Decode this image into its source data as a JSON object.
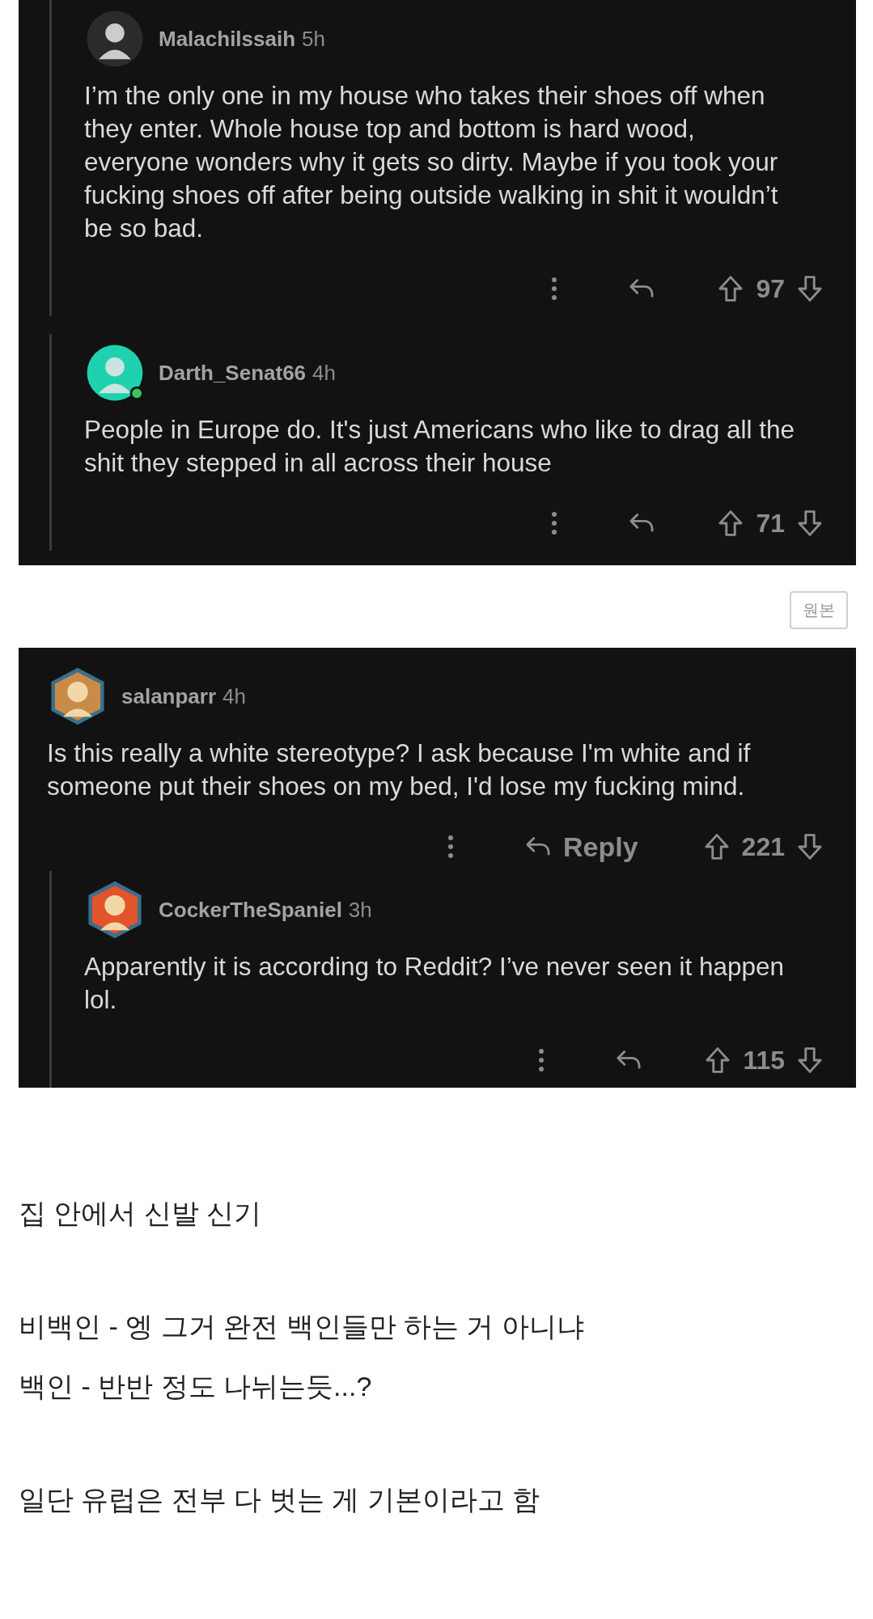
{
  "panels": [
    {
      "replies": [
        {
          "username": "Malachilssaih",
          "age": "5h",
          "avatar": {
            "kind": "circle",
            "color": "#2b2b2b"
          },
          "online": false,
          "body": "I’m the only one in my house who takes their shoes off when they enter. Whole house top and bottom is hard wood, everyone wonders why it gets so dirty. Maybe if you took your fucking shoes off after being outside walking in shit it wouldn’t be so bad.",
          "score": "97"
        },
        {
          "username": "Darth_Senat66",
          "age": "4h",
          "avatar": {
            "kind": "circle",
            "color": "#1fd1ae"
          },
          "online": true,
          "body": "People in Europe do. It's just Americans who like to drag all the shit they stepped in all across their house",
          "score": "71"
        }
      ]
    },
    {
      "comments": [
        {
          "username": "salanparr",
          "age": "4h",
          "avatar": {
            "kind": "hexagon",
            "color": "#c98c48"
          },
          "online": false,
          "body": "Is this really a white stereotype? I ask because I'm white and if someone put their shoes on my bed, I'd lose my fucking mind.",
          "reply_label": "Reply",
          "score": "221",
          "children": [
            {
              "username": "CockerTheSpaniel",
              "age": "3h",
              "avatar": {
                "kind": "hexagon",
                "color": "#e2542a"
              },
              "online": false,
              "body": "Apparently it is according to Reddit? I’ve never seen it happen lol.",
              "score": "115"
            }
          ]
        }
      ]
    }
  ],
  "original_button": "원본",
  "paragraphs": [
    [
      "집 안에서 신발 신기"
    ],
    [
      "비백인 - 엥 그거 완전 백인들만 하는 거 아니냐",
      "백인 - 반반 정도 나뉘는듯...?"
    ],
    [
      "일단 유럽은 전부 다 벗는 게 기본이라고 함"
    ]
  ]
}
